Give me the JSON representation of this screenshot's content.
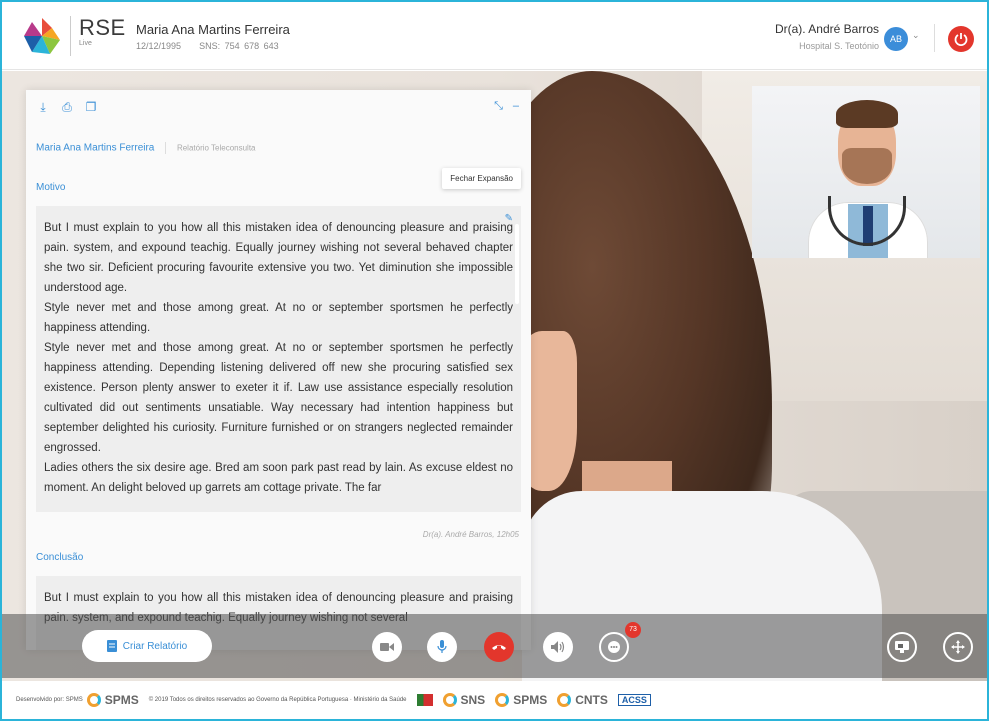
{
  "header": {
    "brand": "RSE",
    "brand_sub": "Live",
    "patient_name": "Maria Ana Martins Ferreira",
    "patient_dob": "12/12/1995",
    "patient_sns": "SNS: 754 678 643",
    "doctor_name": "Dr(a). André Barros",
    "doctor_hospital": "Hospital S. Teotónio",
    "avatar_initials": "AB"
  },
  "panel": {
    "breadcrumb_name": "Maria Ana Martins Ferreira",
    "breadcrumb_doc": "Relatório Teleconsulta",
    "tooltip": "Fechar Expansão",
    "motivo_label": "Motivo",
    "motivo_paragraphs": [
      "But I must explain to you how all this mistaken idea of denouncing pleasure and praising pain. system, and expound teachig. Equally journey wishing not several behaved chapter she two sir. Deficient procuring favourite extensive you two. Yet diminution she impossible understood age.",
      "Style never met and those among great. At no or september sportsmen he perfectly happiness attending.",
      "Style never met and those among great. At no or september sportsmen he perfectly happiness attending. Depending listening delivered off new she procuring satisfied sex existence. Person plenty answer to exeter it if. Law use assistance especially resolution cultivated did out sentiments unsatiable. Way necessary had intention happiness but september delighted his curiosity. Furniture furnished or on strangers neglected remainder engrossed.",
      "Ladies others the six desire age. Bred am soon park past read by lain. As excuse eldest no moment. An delight beloved up garrets am cottage private. The far"
    ],
    "signature": "Dr(a). André Barros, 12h05",
    "conclusao_label": "Conclusão",
    "conclusao_text": "But I must explain to you how all this mistaken idea of denouncing pleasure and praising pain. system, and expound teachig. Equally journey wishing not several"
  },
  "controls": {
    "create_report": "Criar Relatório",
    "chat_badge": "73"
  },
  "footer": {
    "developed_by": "Desenvolvido por: SPMS",
    "spms": "SPMS",
    "copyright": "© 2019 Todos os direitos reservados ao Governo da República Portuguesa · Ministério da Saúde",
    "sns": "SNS",
    "spms2": "SPMS",
    "cnts": "CNTS",
    "acss": "ACSS"
  },
  "colors": {
    "accent": "#3a8fd6",
    "danger": "#e3362c",
    "frame": "#2bb4d9"
  }
}
